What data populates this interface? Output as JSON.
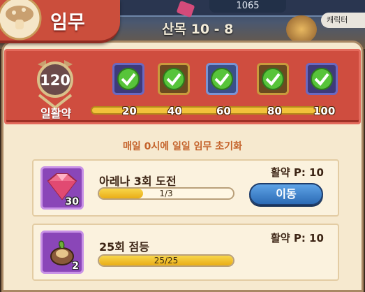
{
  "window": {
    "title": "임무"
  },
  "background": {
    "currency_value": "1065",
    "stage_text": "10 - 8",
    "stage_prefix_partial": "산목",
    "chip_label": "캐릭터"
  },
  "activity": {
    "points": "120",
    "label": "일활약",
    "progress": 1.0,
    "milestones": [
      {
        "value": "20",
        "claimed": true
      },
      {
        "value": "40",
        "claimed": true
      },
      {
        "value": "60",
        "claimed": true
      },
      {
        "value": "80",
        "claimed": true
      },
      {
        "value": "100",
        "claimed": true
      }
    ]
  },
  "reset_notice": "매일 0시에 일일 임무 초기화",
  "missions": [
    {
      "title": "아레나 3회 도전",
      "progress_text": "1/3",
      "progress": 0.333,
      "reward_qty": "30",
      "points": "활약 P: 10",
      "button": "이동",
      "reward_icon": "pink-gem-icon"
    },
    {
      "title": "25회 점등",
      "progress_text": "25/25",
      "progress": 1.0,
      "reward_qty": "2",
      "points": "활약 P: 10",
      "reward_icon": "food-item-icon"
    }
  ],
  "colors": {
    "header_red": "#cf4d3f",
    "panel": "#f6e9cf",
    "bar_yellow": "#f2c23a",
    "button_blue": "#2c6bb5"
  }
}
